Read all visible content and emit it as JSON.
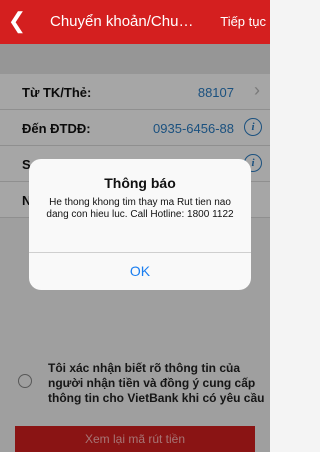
{
  "navbar": {
    "back_icon": "chevron-left-icon",
    "title": "Chuyển khoản/Chuyển tiền",
    "next_label": "Tiếp tục"
  },
  "form": {
    "from_label": "Từ TK/Thẻ:",
    "from_value": "88107",
    "to_label": "Đến ĐTDĐ:",
    "to_value": "0935-6456-88",
    "row3_label_partial": "S",
    "row4_label_partial": "N"
  },
  "confirm": {
    "text": "Tôi xác nhận biết rõ thông tin của người nhận tiền và đồng ý cung cấp thông tin cho VietBank khi có yêu cầu"
  },
  "bottom_button": {
    "label": "Xem lại mã rút tiền"
  },
  "dialog": {
    "title": "Thông báo",
    "message": "He thong khong tim thay ma Rut tien nao dang con hieu luc. Call Hotline: 1800 1122",
    "ok_label": "OK"
  },
  "colors": {
    "brand_red": "#d41f1f",
    "link_blue": "#2a7dc4",
    "ios_blue": "#1a7ef0"
  }
}
